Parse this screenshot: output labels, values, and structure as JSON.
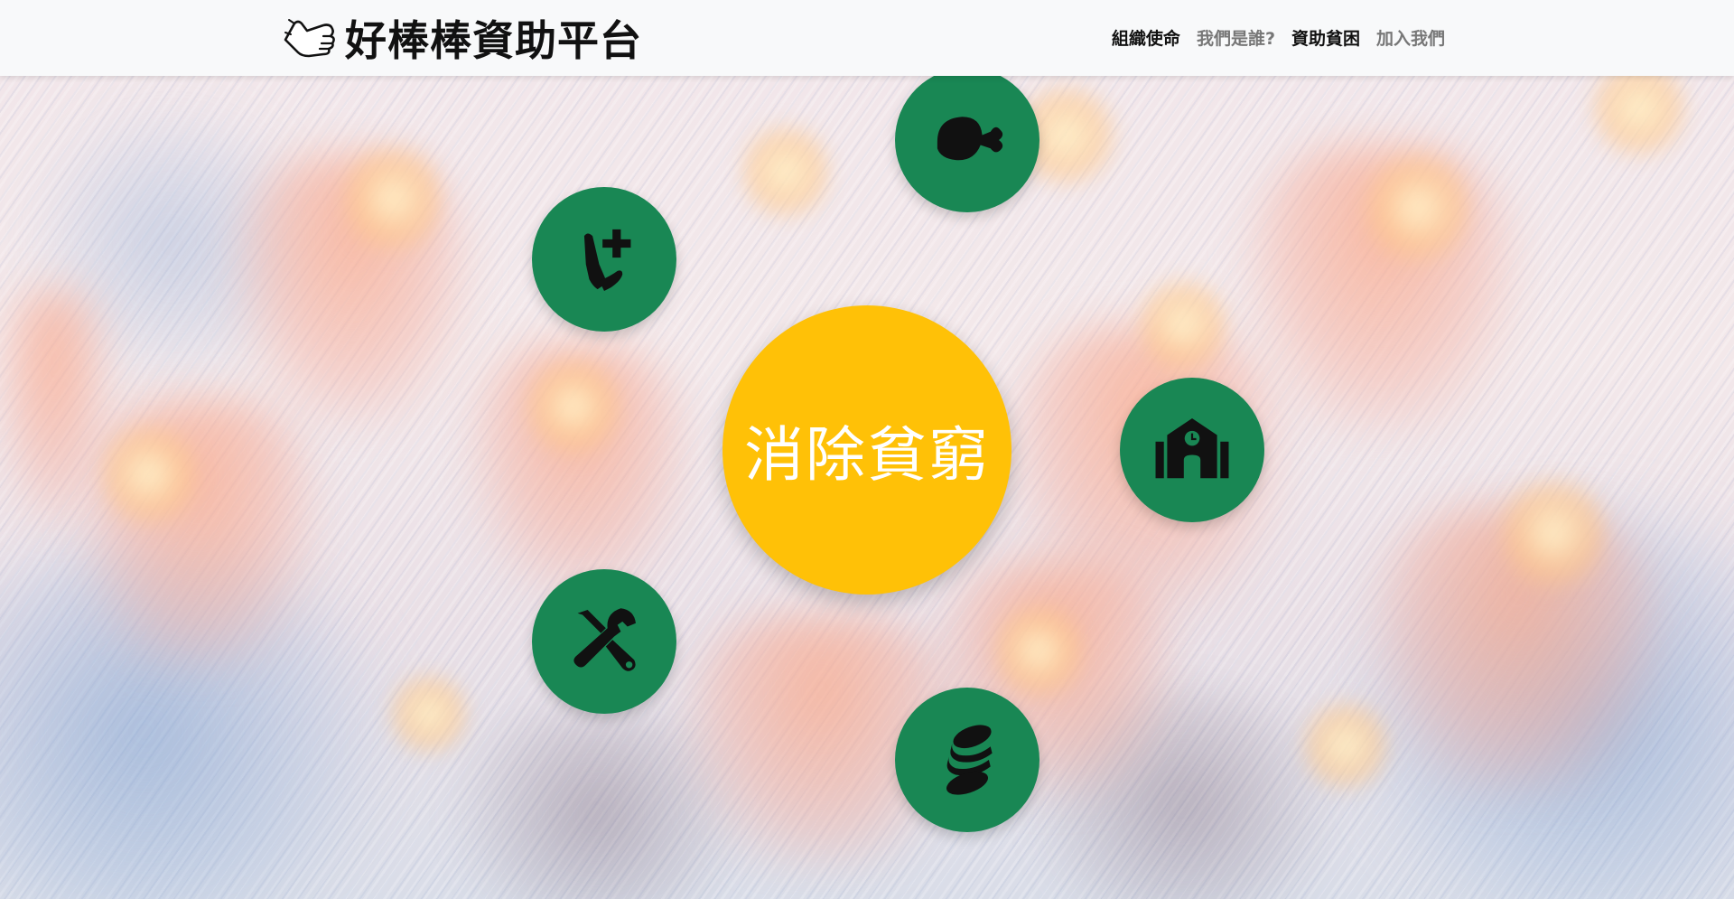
{
  "brand": {
    "name": "好棒棒資助平台",
    "logo_icon": "thumbs-up-hand-icon"
  },
  "nav": {
    "items": [
      {
        "label": "組織使命",
        "state": "active"
      },
      {
        "label": "我們是誰?",
        "state": "muted"
      },
      {
        "label": "資助貧困",
        "state": "active"
      },
      {
        "label": "加入我們",
        "state": "muted"
      }
    ]
  },
  "hub": {
    "center_label": "消除貧窮",
    "center_color": "#ffc107",
    "satellite_color": "#198754",
    "satellites": [
      {
        "icon": "drumstick-food-icon"
      },
      {
        "icon": "hand-medical-icon"
      },
      {
        "icon": "school-icon"
      },
      {
        "icon": "tools-icon"
      },
      {
        "icon": "coins-icon"
      }
    ]
  }
}
